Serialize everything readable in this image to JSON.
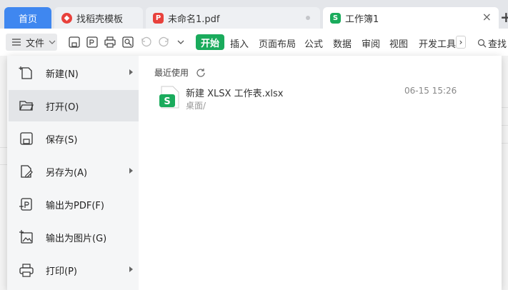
{
  "tabs": {
    "home": "首页",
    "docer": "找稻壳模板",
    "pdf": "未命名1.pdf",
    "workbook": "工作簿1",
    "workbook_badge": "S",
    "close": "×",
    "new_tab": "+"
  },
  "toolbar": {
    "file_menu": "文件",
    "start": "开始",
    "tabs": [
      "插入",
      "页面布局",
      "公式",
      "数据",
      "审阅",
      "视图",
      "开发工具"
    ],
    "more": "›",
    "search": "查找"
  },
  "file_menu": {
    "items": [
      {
        "label": "新建(N)",
        "icon": "new-file-icon",
        "has_submenu": true
      },
      {
        "label": "打开(O)",
        "icon": "folder-open-icon",
        "has_submenu": false,
        "active": true
      },
      {
        "label": "保存(S)",
        "icon": "save-icon",
        "has_submenu": false
      },
      {
        "label": "另存为(A)",
        "icon": "save-as-icon",
        "has_submenu": true
      },
      {
        "label": "输出为PDF(F)",
        "icon": "export-pdf-icon",
        "has_submenu": false
      },
      {
        "label": "输出为图片(G)",
        "icon": "export-image-icon",
        "has_submenu": false
      },
      {
        "label": "打印(P)",
        "icon": "printer-icon",
        "has_submenu": true
      }
    ]
  },
  "recent": {
    "title": "最近使用",
    "files": [
      {
        "name": "新建 XLSX 工作表.xlsx",
        "path": "桌面/",
        "time": "06-15 15:26",
        "badge": "S"
      }
    ]
  },
  "colors": {
    "accent_blue": "#3f87f0",
    "wps_green": "#1aab5c",
    "docer_red": "#e8413c",
    "pdf_red": "#e8413c"
  }
}
